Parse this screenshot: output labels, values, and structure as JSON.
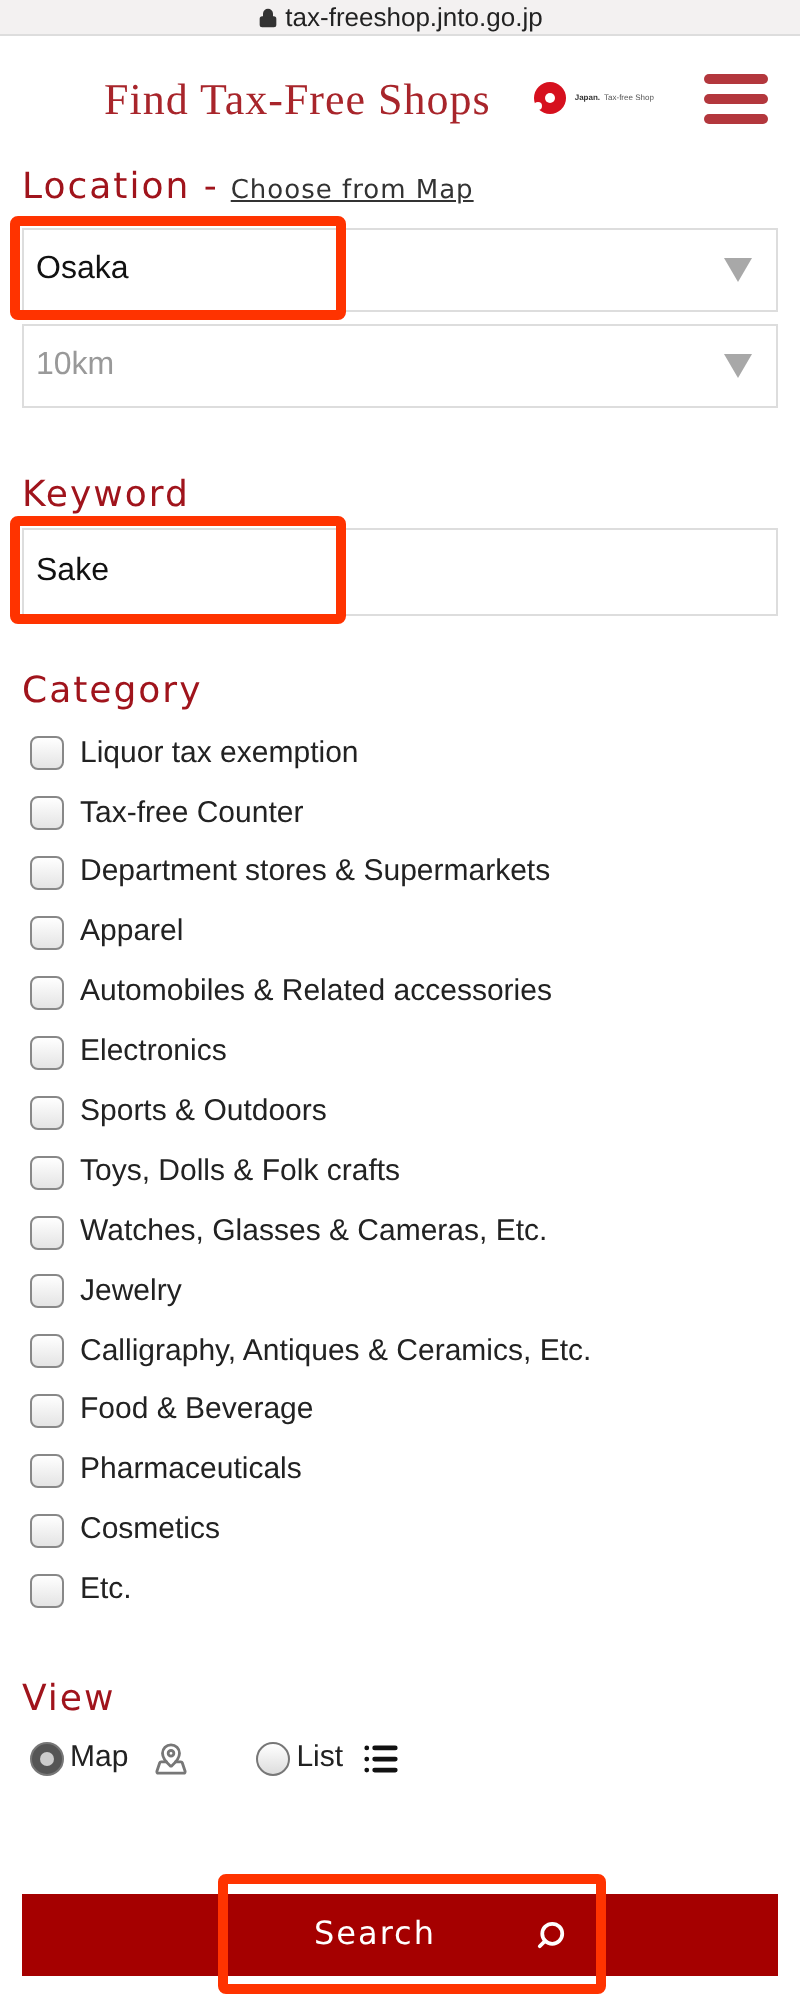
{
  "browser": {
    "url": "tax-freeshop.jnto.go.jp"
  },
  "header": {
    "title": "Find Tax-Free Shops",
    "logo_text": [
      "Japan.",
      "Tax-free Shop"
    ]
  },
  "location": {
    "label": "Location -",
    "map_link": "Choose from Map",
    "city": {
      "value": "Osaka",
      "highlighted": true
    },
    "radius": {
      "value": "10km"
    }
  },
  "keyword": {
    "label": "Keyword",
    "value": "Sake",
    "highlighted": true
  },
  "category": {
    "label": "Category",
    "items": [
      {
        "label": "Liquor tax exemption",
        "checked": false
      },
      {
        "label": "Tax-free Counter",
        "checked": false
      },
      {
        "label": "Department stores & Supermarkets",
        "checked": false
      },
      {
        "label": "Apparel",
        "checked": false
      },
      {
        "label": "Automobiles & Related accessories",
        "checked": false
      },
      {
        "label": "Electronics",
        "checked": false
      },
      {
        "label": "Sports & Outdoors",
        "checked": false
      },
      {
        "label": "Toys, Dolls & Folk crafts",
        "checked": false
      },
      {
        "label": "Watches, Glasses & Cameras, Etc.",
        "checked": false
      },
      {
        "label": "Jewelry",
        "checked": false
      },
      {
        "label": "Calligraphy, Antiques & Ceramics, Etc.",
        "checked": false
      },
      {
        "label": "Food & Beverage",
        "checked": false
      },
      {
        "label": "Pharmaceuticals",
        "checked": false
      },
      {
        "label": "Cosmetics",
        "checked": false
      },
      {
        "label": "Etc.",
        "checked": false
      }
    ]
  },
  "view": {
    "label": "View",
    "options": [
      {
        "label": "Map",
        "kind": "map",
        "selected": true
      },
      {
        "label": "List",
        "kind": "list",
        "selected": false
      }
    ]
  },
  "search_button": {
    "label": "Search",
    "highlighted": true
  }
}
